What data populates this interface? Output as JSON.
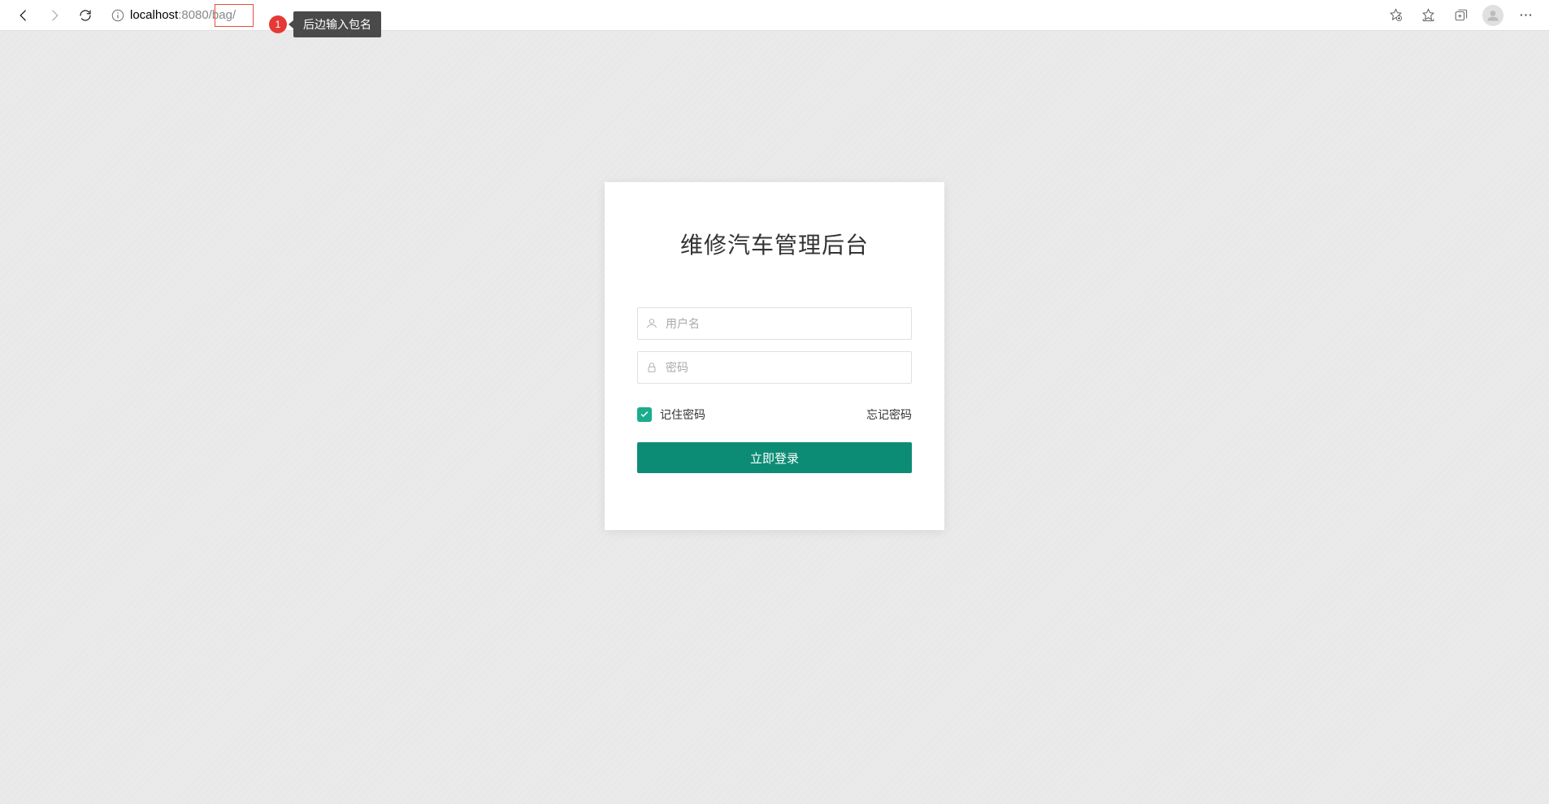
{
  "browser": {
    "url_host": "localhost",
    "url_port": ":8080",
    "url_path": "/bag/",
    "annotation_number": "1",
    "annotation_text": "后边输入包名"
  },
  "login": {
    "title": "维修汽车管理后台",
    "username_placeholder": "用户名",
    "password_placeholder": "密码",
    "remember_label": "记住密码",
    "forgot_label": "忘记密码",
    "submit_label": "立即登录"
  }
}
